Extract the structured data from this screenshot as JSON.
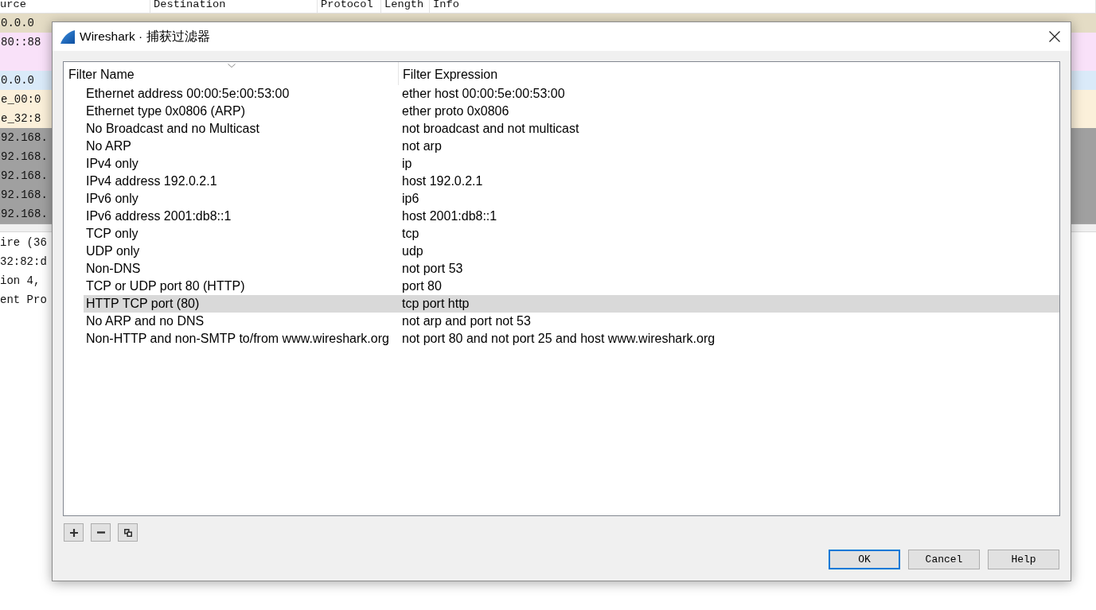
{
  "wireshark_main": {
    "packet_list": {
      "columns": [
        "urce",
        "Destination",
        "Protocol",
        "Length",
        "Info"
      ],
      "rows": [
        {
          "text": "0.0.0",
          "color": "#e4dcc5"
        },
        {
          "text": "80::88",
          "color": "#f9e1f9"
        },
        {
          "color": "#f9e1f9"
        },
        {
          "text": "0.0.0",
          "color": "#daeaf9"
        },
        {
          "text": "e_00:0",
          "color": "#fbf0da"
        },
        {
          "text": "e_32:8",
          "color": "#fbf0da"
        },
        {
          "text": "92.168.",
          "color": "#a0a0a0"
        },
        {
          "text": "92.168.",
          "color": "#a0a0a0"
        },
        {
          "text": "92.168.",
          "color": "#a0a0a0"
        },
        {
          "text": "92.168.",
          "color": "#a0a0a0"
        },
        {
          "text": "92.168.",
          "color": "#a0a0a0"
        }
      ]
    },
    "packet_details": [
      "ire (36",
      "32:82:d",
      "ion 4,",
      "ent Pro"
    ]
  },
  "dialog": {
    "title": "Wireshark · 捕获过滤器",
    "table": {
      "columns": [
        {
          "label": "Filter Name",
          "sorted": true
        },
        {
          "label": "Filter Expression",
          "sorted": false
        }
      ],
      "rows": [
        {
          "name": "Ethernet address 00:00:5e:00:53:00",
          "expression": "ether host 00:00:5e:00:53:00",
          "selected": false
        },
        {
          "name": "Ethernet type 0x0806 (ARP)",
          "expression": "ether proto 0x0806",
          "selected": false
        },
        {
          "name": "No Broadcast and no Multicast",
          "expression": "not broadcast and not multicast",
          "selected": false
        },
        {
          "name": "No ARP",
          "expression": "not arp",
          "selected": false
        },
        {
          "name": "IPv4 only",
          "expression": "ip",
          "selected": false
        },
        {
          "name": "IPv4 address 192.0.2.1",
          "expression": "host 192.0.2.1",
          "selected": false
        },
        {
          "name": "IPv6 only",
          "expression": "ip6",
          "selected": false
        },
        {
          "name": "IPv6 address 2001:db8::1",
          "expression": "host 2001:db8::1",
          "selected": false
        },
        {
          "name": "TCP only",
          "expression": "tcp",
          "selected": false
        },
        {
          "name": "UDP only",
          "expression": "udp",
          "selected": false
        },
        {
          "name": "Non-DNS",
          "expression": "not port 53",
          "selected": false
        },
        {
          "name": "TCP or UDP port 80 (HTTP)",
          "expression": "port 80",
          "selected": false
        },
        {
          "name": "HTTP TCP port (80)",
          "expression": "tcp port http",
          "selected": true
        },
        {
          "name": "No ARP and no DNS",
          "expression": "not arp and port not 53",
          "selected": false
        },
        {
          "name": "Non-HTTP and non-SMTP to/from www.wireshark.org",
          "expression": "not port 80 and not port 25 and host www.wireshark.org",
          "selected": false
        }
      ]
    },
    "toolbar": [
      {
        "kind": "add"
      },
      {
        "kind": "remove"
      },
      {
        "kind": "copy"
      }
    ],
    "buttons": [
      {
        "label": "OK",
        "default": true
      },
      {
        "label": "Cancel",
        "default": false
      },
      {
        "label": "Help",
        "default": false
      }
    ]
  }
}
